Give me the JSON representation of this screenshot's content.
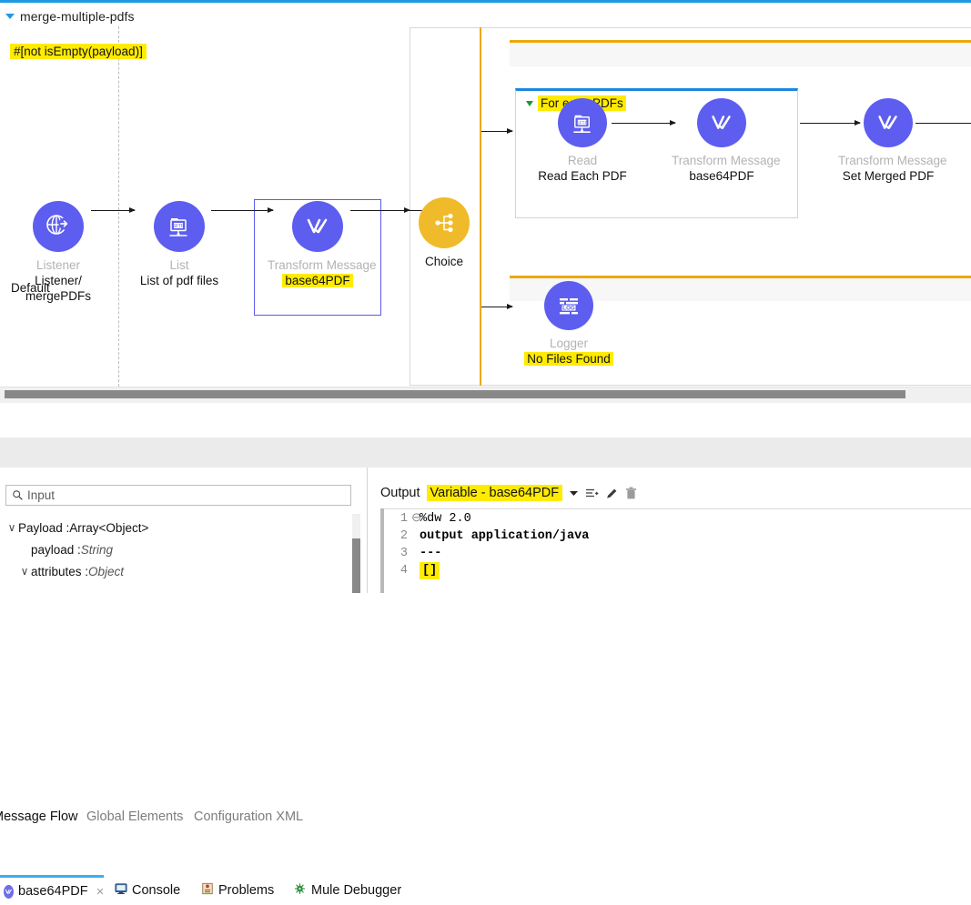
{
  "flow": {
    "title": "merge-multiple-pdfs",
    "collapse_icon": "triangle-down-icon"
  },
  "canvas": {
    "nodes": [
      {
        "id": "listener",
        "icon": "http-listener-globe-icon",
        "type": "Listener",
        "name_line1": "Listener/",
        "name_line2": "mergePDFs",
        "highlighted": false
      },
      {
        "id": "list",
        "icon": "sftp-list-icon",
        "type": "List",
        "name_line1": "List of pdf files",
        "name_line2": "",
        "highlighted": false
      },
      {
        "id": "transform-base64",
        "icon": "transform-message-icon",
        "type": "Transform Message",
        "name_line1": "base64PDF",
        "name_line2": "",
        "highlighted": true
      },
      {
        "id": "choice",
        "icon": "choice-router-icon",
        "type": "",
        "name_line1": "Choice",
        "name_line2": "",
        "highlighted": false
      },
      {
        "id": "read-each-pdf",
        "icon": "sftp-read-icon",
        "type": "Read",
        "name_line1": "Read Each PDF",
        "name_line2": "",
        "highlighted": false
      },
      {
        "id": "transform-inner",
        "icon": "transform-message-icon",
        "type": "Transform Message",
        "name_line1": "base64PDF",
        "name_line2": "",
        "highlighted": false
      },
      {
        "id": "set-merged-pdf",
        "icon": "transform-message-icon",
        "type": "Transform Message",
        "name_line1": "Set Merged PDF",
        "name_line2": "",
        "highlighted": false
      },
      {
        "id": "logger",
        "icon": "logger-icon",
        "type": "Logger",
        "name_line1": "No Files Found",
        "name_line2": "",
        "highlighted": true
      }
    ],
    "when_condition": "#[not isEmpty(payload)]",
    "foreach_label": "For each PDFs",
    "default_label": "Default",
    "colors": {
      "node_purple": "#5d5ef0",
      "node_amber": "#f0bb2a",
      "scope_orange": "#eda80f",
      "scope_blue": "#1e86e0",
      "selection_blue": "#5a5af0",
      "highlight_yellow": "#ffeb00"
    }
  },
  "editor_tabs": [
    {
      "label": "Message Flow",
      "active": true
    },
    {
      "label": "Global Elements",
      "active": false
    },
    {
      "label": "Configuration XML",
      "active": false
    }
  ],
  "view_tabs": [
    {
      "label": "base64PDF",
      "icon": "transform-message-icon",
      "selected": true,
      "closeable": true,
      "close_glyph": "×"
    },
    {
      "label": "Console",
      "icon": "console-icon",
      "selected": false
    },
    {
      "label": "Problems",
      "icon": "problems-icon",
      "selected": false
    },
    {
      "label": "Mule Debugger",
      "icon": "mule-debugger-icon",
      "selected": false
    }
  ],
  "input_panel": {
    "search": {
      "placeholder": "Input",
      "value": "",
      "icon": "search-icon"
    },
    "tree": [
      {
        "indent": 0,
        "chevron": "∨",
        "label": "Payload : ",
        "type": "Array<Object>",
        "type_italic": false
      },
      {
        "indent": 1,
        "chevron": "",
        "label": "payload : ",
        "type": "String",
        "type_italic": true
      },
      {
        "indent": 0,
        "chevron": "∨",
        "label": "attributes : ",
        "type": "Object",
        "type_italic": true
      }
    ]
  },
  "output_panel": {
    "label": "Output",
    "variable": "Variable - base64PDF",
    "toolbar": [
      {
        "icon": "chevron-down-icon",
        "glyph": "▼"
      },
      {
        "icon": "add-list-icon",
        "glyph": ""
      },
      {
        "icon": "edit-pencil-icon",
        "glyph": ""
      },
      {
        "icon": "trash-icon",
        "glyph": ""
      }
    ],
    "code_lines": [
      {
        "n": "1",
        "fold": "⊖",
        "text": "%dw 2.0",
        "bold": false,
        "highlight": false
      },
      {
        "n": "2",
        "fold": "",
        "text": "output application/java",
        "bold": true,
        "highlight": false
      },
      {
        "n": "3",
        "fold": "",
        "text": "---",
        "bold": true,
        "highlight": false
      },
      {
        "n": "4",
        "fold": "",
        "text": "[]",
        "bold": true,
        "highlight": true
      }
    ]
  }
}
